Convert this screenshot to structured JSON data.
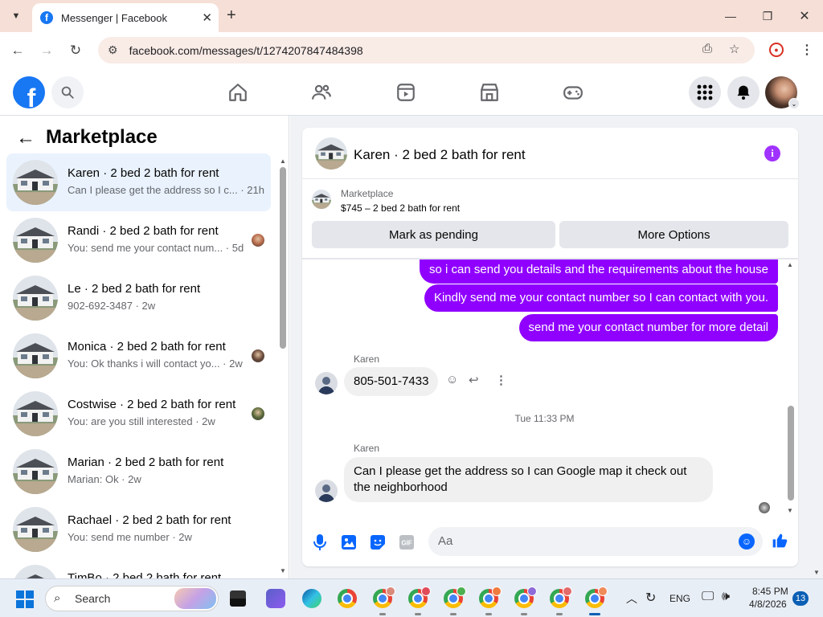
{
  "browser": {
    "tab_title": "Messenger | Facebook",
    "url": "facebook.com/messages/t/1274207847484398"
  },
  "marketplace": {
    "title": "Marketplace",
    "conversations": [
      {
        "name": "Karen · 2 bed 2 bath for rent",
        "preview": "Can I please get the address so I c... · 21h",
        "active": true
      },
      {
        "name": "Randi · 2 bed 2 bath for rent",
        "preview": "You: send me your contact num... · 5d"
      },
      {
        "name": "Le · 2 bed 2 bath for rent",
        "preview": "902-692-3487 · 2w"
      },
      {
        "name": "Monica · 2 bed 2 bath for rent",
        "preview": "You: Ok thanks i will contact yo... · 2w"
      },
      {
        "name": "Costwise · 2 bed 2 bath for rent",
        "preview": "You: are you still interested · 2w"
      },
      {
        "name": "Marian · 2 bed 2 bath for rent",
        "preview": "Marian: Ok · 2w"
      },
      {
        "name": "Rachael · 2 bed 2 bath for rent",
        "preview": "You: send me number · 2w"
      },
      {
        "name": "TimBo · 2 bed 2 bath for rent",
        "preview": ""
      }
    ]
  },
  "chat": {
    "title": "Karen · 2 bed 2 bath for rent",
    "listing_label": "Marketplace",
    "listing_price": "$745 – 2 bed 2 bath for rent",
    "mark_pending_label": "Mark as pending",
    "more_options_label": "More Options",
    "messages_out": [
      "so i can send you details and the requirements about the house",
      "Kindly send me your contact number so I can contact with you.",
      "send me your contact number for more detail"
    ],
    "sender_name": "Karen",
    "phone_message": "805-501-7433",
    "timestamp": "Tue 11:33 PM",
    "last_message": "Can I please get the address so I can Google map it check out the neighborhood",
    "composer_placeholder": "Aa"
  },
  "taskbar": {
    "search_label": "Search",
    "language": "ENG",
    "time": "8:45 PM",
    "date": "4/8/2026",
    "notification_count": "13"
  },
  "colors": {
    "facebook_blue": "#1877f2",
    "message_purple": "#9000ff",
    "active_conversation": "#e9f2fd"
  }
}
